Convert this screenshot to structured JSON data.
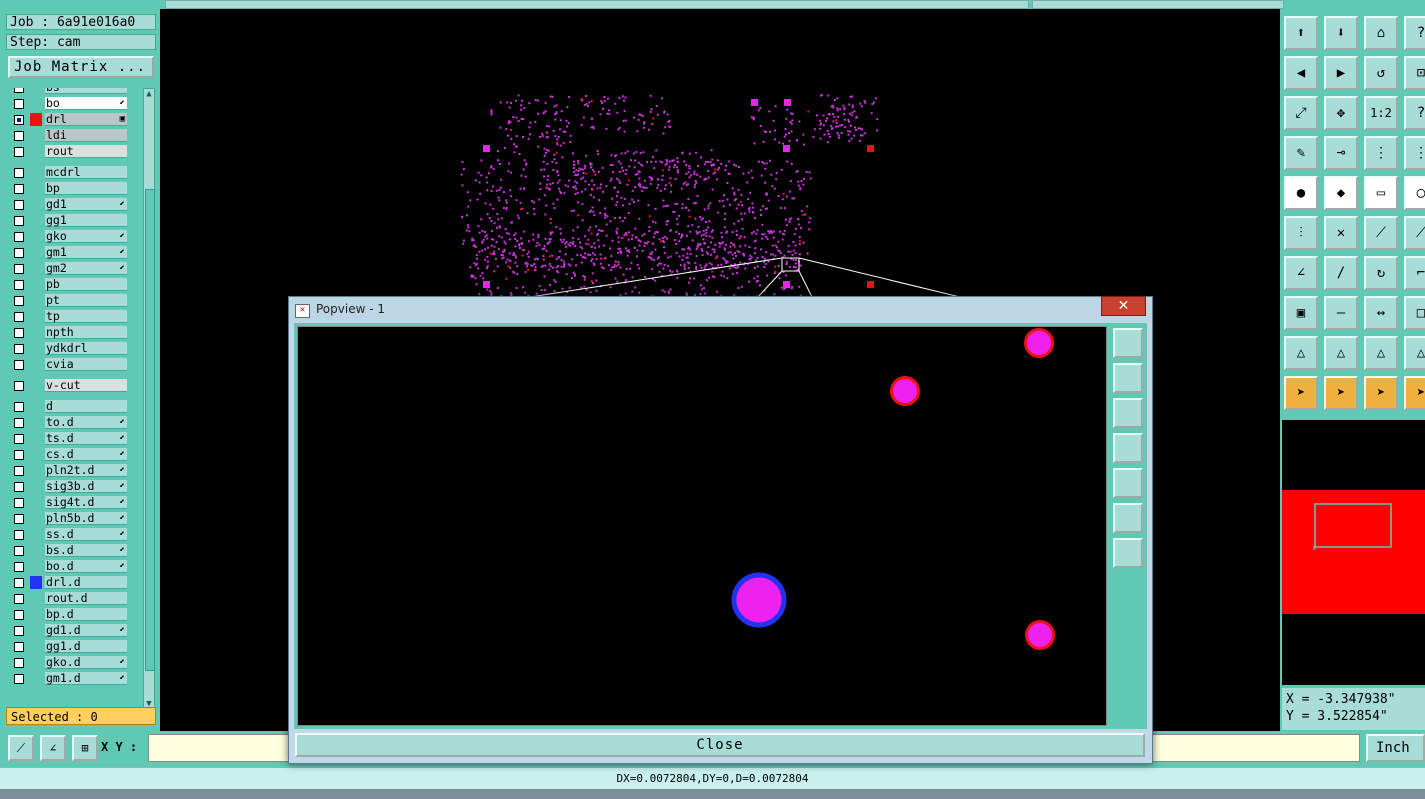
{
  "job": {
    "job_label": "Job : 6a91e016a0",
    "step_label": "Step: cam"
  },
  "job_matrix_button": "Job Matrix ...",
  "layers": [
    {
      "name": "bs",
      "checked": false,
      "swatch": "",
      "style": "",
      "mark": "⬋"
    },
    {
      "name": "bo",
      "checked": false,
      "swatch": "",
      "style": "white",
      "mark": "⬋"
    },
    {
      "name": "drl",
      "checked": true,
      "swatch": "#ee1111",
      "style": "gray",
      "mark": "▣"
    },
    {
      "name": "ldi",
      "checked": false,
      "swatch": "",
      "style": "gray",
      "mark": ""
    },
    {
      "name": "rout",
      "checked": false,
      "swatch": "",
      "style": "ltgray",
      "mark": ""
    },
    {
      "name": "mcdrl",
      "checked": false,
      "swatch": "",
      "style": "",
      "mark": ""
    },
    {
      "name": "bp",
      "checked": false,
      "swatch": "",
      "style": "",
      "mark": ""
    },
    {
      "name": "gd1",
      "checked": false,
      "swatch": "",
      "style": "",
      "mark": "⬋"
    },
    {
      "name": "gg1",
      "checked": false,
      "swatch": "",
      "style": "",
      "mark": ""
    },
    {
      "name": "gko",
      "checked": false,
      "swatch": "",
      "style": "",
      "mark": "⬋"
    },
    {
      "name": "gm1",
      "checked": false,
      "swatch": "",
      "style": "",
      "mark": "⬋"
    },
    {
      "name": "gm2",
      "checked": false,
      "swatch": "",
      "style": "",
      "mark": "⬋"
    },
    {
      "name": "pb",
      "checked": false,
      "swatch": "",
      "style": "",
      "mark": ""
    },
    {
      "name": "pt",
      "checked": false,
      "swatch": "",
      "style": "",
      "mark": ""
    },
    {
      "name": "tp",
      "checked": false,
      "swatch": "",
      "style": "",
      "mark": ""
    },
    {
      "name": "npth",
      "checked": false,
      "swatch": "",
      "style": "",
      "mark": ""
    },
    {
      "name": "ydkdrl",
      "checked": false,
      "swatch": "",
      "style": "",
      "mark": ""
    },
    {
      "name": "cvia",
      "checked": false,
      "swatch": "",
      "style": "",
      "mark": ""
    },
    {
      "name": "v-cut",
      "checked": false,
      "swatch": "",
      "style": "ltgray",
      "mark": ""
    },
    {
      "name": "d",
      "checked": false,
      "swatch": "",
      "style": "",
      "mark": ""
    },
    {
      "name": "to.d",
      "checked": false,
      "swatch": "",
      "style": "",
      "mark": "⬋"
    },
    {
      "name": "ts.d",
      "checked": false,
      "swatch": "",
      "style": "",
      "mark": "⬋"
    },
    {
      "name": "cs.d",
      "checked": false,
      "swatch": "",
      "style": "",
      "mark": "⬋"
    },
    {
      "name": "pln2t.d",
      "checked": false,
      "swatch": "",
      "style": "",
      "mark": "⬋"
    },
    {
      "name": "sig3b.d",
      "checked": false,
      "swatch": "",
      "style": "",
      "mark": "⬋"
    },
    {
      "name": "sig4t.d",
      "checked": false,
      "swatch": "",
      "style": "",
      "mark": "⬋"
    },
    {
      "name": "pln5b.d",
      "checked": false,
      "swatch": "",
      "style": "",
      "mark": "⬋"
    },
    {
      "name": "ss.d",
      "checked": false,
      "swatch": "",
      "style": "",
      "mark": "⬋"
    },
    {
      "name": "bs.d",
      "checked": false,
      "swatch": "",
      "style": "",
      "mark": "⬋"
    },
    {
      "name": "bo.d",
      "checked": false,
      "swatch": "",
      "style": "",
      "mark": "⬋"
    },
    {
      "name": "drl.d",
      "checked": false,
      "swatch": "#2233ee",
      "style": "",
      "mark": ""
    },
    {
      "name": "rout.d",
      "checked": false,
      "swatch": "",
      "style": "",
      "mark": ""
    },
    {
      "name": "bp.d",
      "checked": false,
      "swatch": "",
      "style": "",
      "mark": ""
    },
    {
      "name": "gd1.d",
      "checked": false,
      "swatch": "",
      "style": "",
      "mark": "⬋"
    },
    {
      "name": "gg1.d",
      "checked": false,
      "swatch": "",
      "style": "",
      "mark": ""
    },
    {
      "name": "gko.d",
      "checked": false,
      "swatch": "",
      "style": "",
      "mark": "⬋"
    },
    {
      "name": "gm1.d",
      "checked": false,
      "swatch": "",
      "style": "",
      "mark": "⬋"
    }
  ],
  "selected_label": "Selected : 0",
  "xy_label": "X Y :",
  "xy_value": "",
  "unit_label": "Inch",
  "status_text": "DX=0.0072804,DY=0,D=0.0072804",
  "coords": {
    "x_label": "X = -3.347938\"",
    "y_label": "Y = 3.522854\""
  },
  "popview": {
    "title": "Popview - 1",
    "close_x": "✕",
    "close_label": "Close"
  },
  "colors": {
    "panel": "#5fc9b3",
    "field": "#a8dcd6",
    "pad_magenta": "#ee22ee",
    "pad_red_ring": "#ee1111",
    "pad_blue_ring": "#2233ee",
    "minimap_red": "#ff0000"
  },
  "toolbar": [
    {
      "name": "page-up-icon",
      "glyph": "⬆"
    },
    {
      "name": "page-down-icon",
      "glyph": "⬇"
    },
    {
      "name": "home-icon",
      "glyph": "⌂"
    },
    {
      "name": "help-icon",
      "glyph": "?"
    },
    {
      "name": "pan-left-icon",
      "glyph": "◀"
    },
    {
      "name": "pan-right-icon",
      "glyph": "▶"
    },
    {
      "name": "undo-icon",
      "glyph": "↺"
    },
    {
      "name": "zoom-window-icon",
      "glyph": "⊡"
    },
    {
      "name": "zoom-fit-icon",
      "glyph": "⤢"
    },
    {
      "name": "zoom-center-icon",
      "glyph": "✥"
    },
    {
      "name": "zoom-1to1-icon",
      "glyph": "1:2"
    },
    {
      "name": "query-icon",
      "glyph": "?"
    },
    {
      "name": "measure-icon",
      "glyph": "✎"
    },
    {
      "name": "snap-icon",
      "glyph": "⊸"
    },
    {
      "name": "net-icon",
      "glyph": "⋮"
    },
    {
      "name": "net2-icon",
      "glyph": "⋮"
    },
    {
      "name": "pad-icon",
      "glyph": "●"
    },
    {
      "name": "polygon-icon",
      "glyph": "◆"
    },
    {
      "name": "ruler-icon",
      "glyph": "▭"
    },
    {
      "name": "circle-icon",
      "glyph": "◯"
    },
    {
      "name": "connect-icon",
      "glyph": "⫶"
    },
    {
      "name": "cross-icon",
      "glyph": "✕"
    },
    {
      "name": "line-icon",
      "glyph": "⟋"
    },
    {
      "name": "line2-icon",
      "glyph": "⟋"
    },
    {
      "name": "angle-icon",
      "glyph": "∠"
    },
    {
      "name": "slash-icon",
      "glyph": "/"
    },
    {
      "name": "arc-icon",
      "glyph": "↻"
    },
    {
      "name": "step-icon",
      "glyph": "⌐"
    },
    {
      "name": "pad-add-icon",
      "glyph": "▣"
    },
    {
      "name": "minus-icon",
      "glyph": "—"
    },
    {
      "name": "dimension-icon",
      "glyph": "↔"
    },
    {
      "name": "box-icon",
      "glyph": "□"
    },
    {
      "name": "triangle-icon",
      "glyph": "△"
    },
    {
      "name": "triangle2-icon",
      "glyph": "△"
    },
    {
      "name": "triangle3-icon",
      "glyph": "△"
    },
    {
      "name": "triangle4-icon",
      "glyph": "△"
    },
    {
      "name": "pointer-icon",
      "glyph": "➤"
    },
    {
      "name": "pointer2-icon",
      "glyph": "➤"
    },
    {
      "name": "pointer3-icon",
      "glyph": "➤"
    },
    {
      "name": "pointer4-icon",
      "glyph": "➤"
    }
  ]
}
